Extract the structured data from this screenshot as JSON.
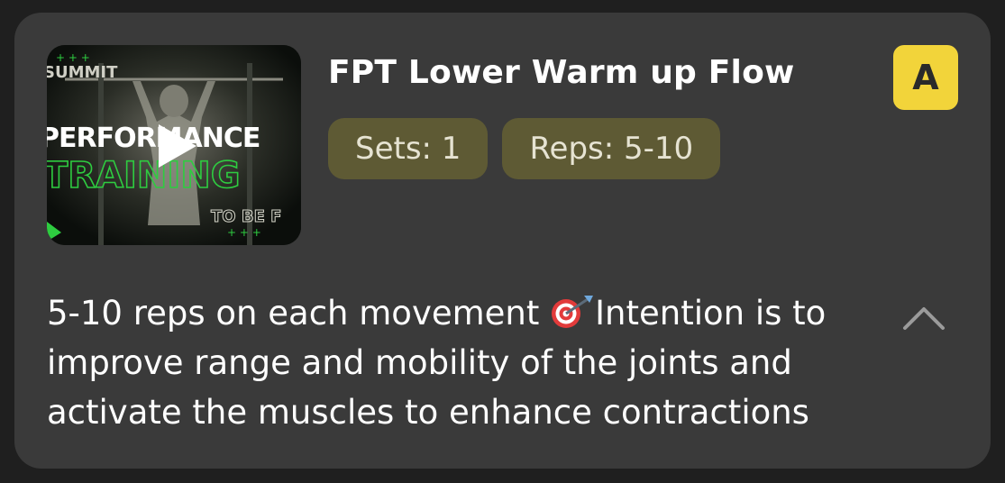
{
  "exercise": {
    "title": "FPT Lower Warm up Flow",
    "sets_label": "Sets: 1",
    "reps_label": "Reps: 5-10",
    "badge": "A",
    "description_before_icon": "5-10 reps on each movement ",
    "description_after_icon": "Intention is to improve range and mobility of the joints and activate the muscles to enhance contractions",
    "video_thumbnail": {
      "line1": "SUMMIT",
      "line2": "PERFORMANCE",
      "line3": "TRAINING",
      "line4": "TO BE F"
    }
  },
  "icons": {
    "play": "play-icon",
    "target": "direct-hit-target-icon",
    "collapse": "chevron-up-icon"
  },
  "colors": {
    "card_bg": "#3a3a3a",
    "chip_bg": "#5e5a34",
    "badge_bg": "#f2d43a",
    "accent_green": "#2ecc40"
  }
}
